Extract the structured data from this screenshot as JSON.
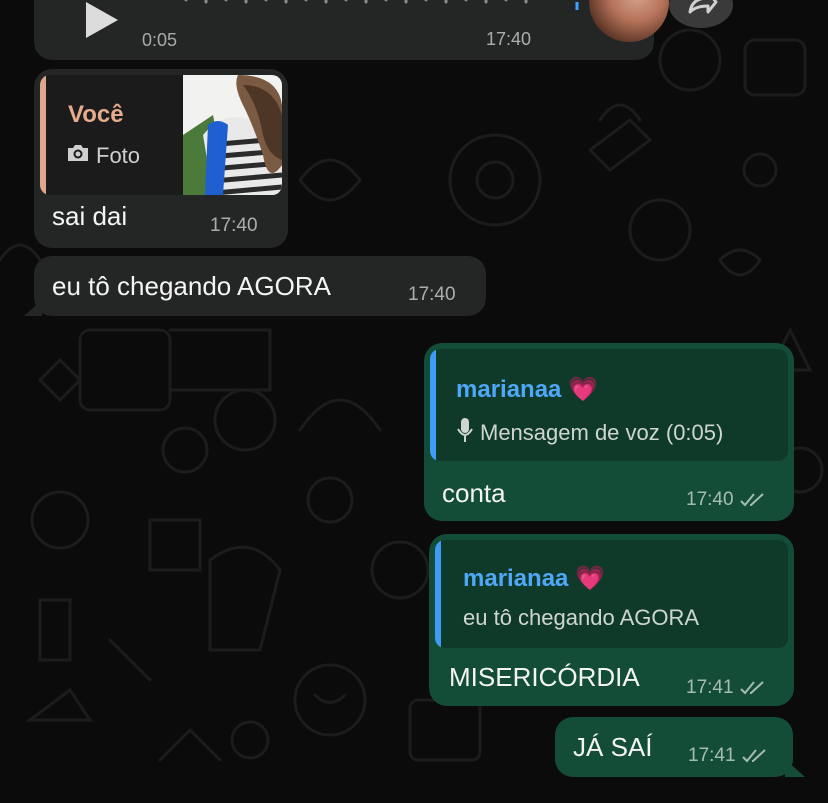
{
  "voice_message": {
    "duration": "0:05",
    "time": "17:40"
  },
  "messages": [
    {
      "quote_author": "Você",
      "quote_type": "Foto",
      "text": "sai dai",
      "time": "17:40"
    },
    {
      "text": "eu tô chegando AGORA",
      "time": "17:40"
    },
    {
      "quote_author": "marianaa 💗",
      "quote_text": "Mensagem de voz (0:05)",
      "text": "conta",
      "time": "17:40"
    },
    {
      "quote_author": "marianaa 💗",
      "quote_text": "eu tô chegando AGORA",
      "text": "MISERICÓRDIA",
      "time": "17:41"
    },
    {
      "text": "JÁ SAÍ",
      "time": "17:41"
    }
  ],
  "colors": {
    "incoming_bubble": "#242626",
    "outgoing_bubble": "#144d37",
    "quote_accent_blue": "#4ea8f7",
    "quote_accent_orange": "#e6ab8c"
  }
}
